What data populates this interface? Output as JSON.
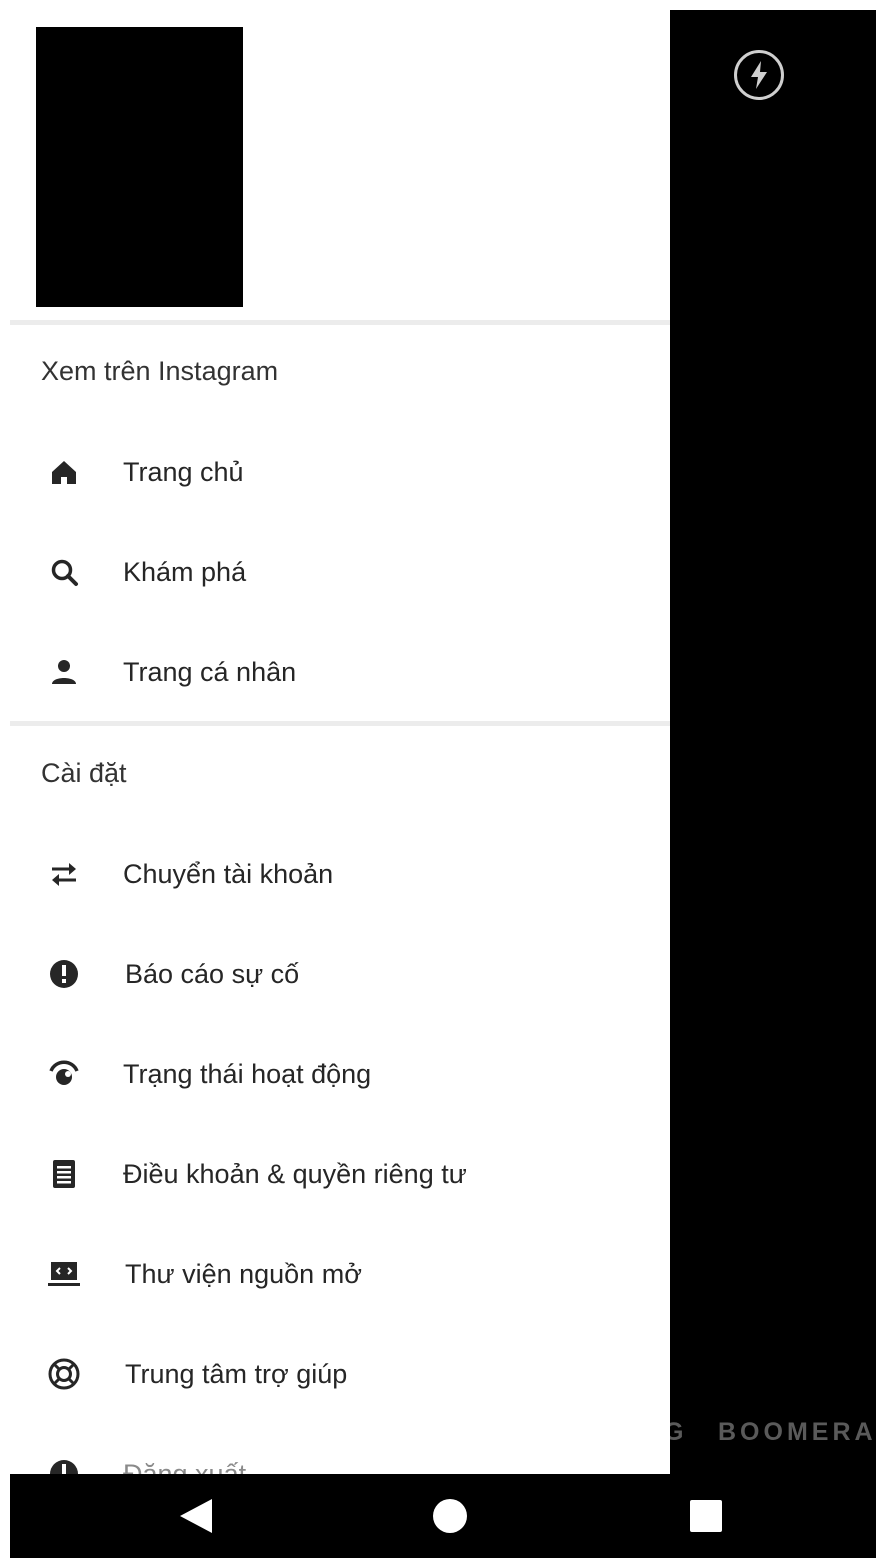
{
  "drawer": {
    "section_view": "Xem trên Instagram",
    "view_items": [
      {
        "label": "Trang chủ",
        "icon": "home-icon"
      },
      {
        "label": "Khám phá",
        "icon": "search-icon"
      },
      {
        "label": "Trang cá nhân",
        "icon": "person-icon"
      }
    ],
    "section_settings": "Cài đặt",
    "settings_items": [
      {
        "label": "Chuyển tài khoản",
        "icon": "swap-icon"
      },
      {
        "label": "Báo cáo sự cố",
        "icon": "alert-icon"
      },
      {
        "label": "Trạng thái hoạt động",
        "icon": "activity-status-icon"
      },
      {
        "label": "Điều khoản & quyền riêng tư",
        "icon": "document-icon"
      },
      {
        "label": "Thư viện nguồn mở",
        "icon": "laptop-code-icon"
      },
      {
        "label": "Trung tâm trợ giúp",
        "icon": "lifebuoy-icon"
      },
      {
        "label": "Đăng xuất",
        "icon": "power-icon"
      }
    ]
  },
  "camera": {
    "mode_partial": "G",
    "mode_boomerang": "BOOMERANG",
    "flash_icon": "flash-icon"
  },
  "navbar": {
    "back_icon": "back-triangle-icon",
    "home_icon": "home-circle-icon",
    "recent_icon": "recent-square-icon"
  },
  "colors": {
    "drawer_bg": "#ffffff",
    "camera_bg": "#000000",
    "divider": "#ececec",
    "text": "#262626"
  }
}
